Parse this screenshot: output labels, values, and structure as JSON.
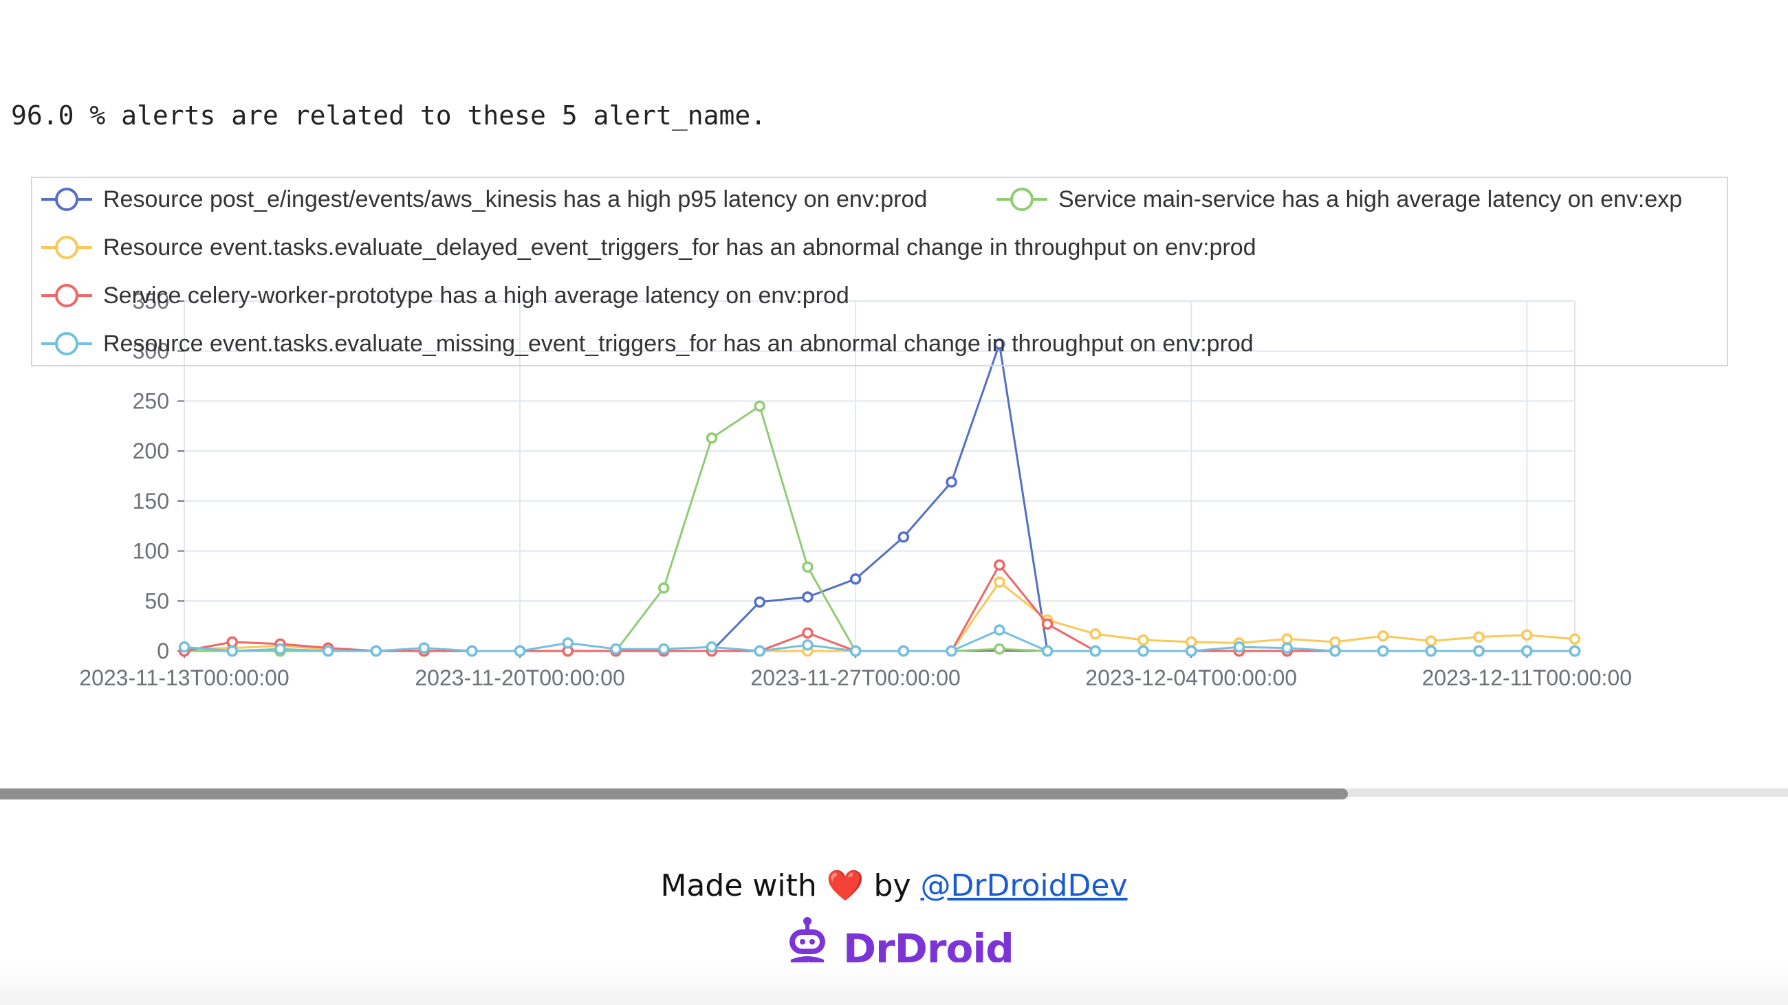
{
  "summary_text": "96.0 % alerts are related to these 5 alert_name.",
  "footer": {
    "made_with": "Made with",
    "heart": "❤️",
    "by": "by",
    "link": "@DrDroidDev",
    "brand_name": "DrDroid"
  },
  "chart_data": {
    "type": "line",
    "title": "",
    "xlabel": "",
    "ylabel": "",
    "ylim": [
      0,
      350
    ],
    "yticks": [
      0,
      50,
      100,
      150,
      200,
      250,
      300,
      350
    ],
    "x_tick_labels": [
      "2023-11-13T00:00:00",
      "2023-11-20T00:00:00",
      "2023-11-27T00:00:00",
      "2023-12-04T00:00:00",
      "2023-12-11T00:00:00"
    ],
    "x": [
      "2023-11-13",
      "2023-11-14",
      "2023-11-15",
      "2023-11-16",
      "2023-11-17",
      "2023-11-18",
      "2023-11-19",
      "2023-11-20",
      "2023-11-21",
      "2023-11-22",
      "2023-11-23",
      "2023-11-24",
      "2023-11-25",
      "2023-11-26",
      "2023-11-27",
      "2023-11-28",
      "2023-11-29",
      "2023-11-30",
      "2023-12-01",
      "2023-12-02",
      "2023-12-03",
      "2023-12-04",
      "2023-12-05",
      "2023-12-06",
      "2023-12-07",
      "2023-12-08",
      "2023-12-09",
      "2023-12-10",
      "2023-12-11",
      "2023-12-12"
    ],
    "grid": true,
    "legend_position": "top",
    "series": [
      {
        "name": "Resource post_e/ingest/events/aws_kinesis has a high p95 latency on env:prod",
        "color": "#5470c6",
        "values": [
          0,
          0,
          0,
          0,
          0,
          0,
          0,
          0,
          0,
          0,
          0,
          0,
          49,
          54,
          72,
          114,
          169,
          307,
          0,
          0,
          0,
          0,
          0,
          0,
          0,
          0,
          0,
          0,
          0,
          0
        ]
      },
      {
        "name": "Service main-service has a high average latency on env:exp",
        "color": "#91cc75",
        "values": [
          0,
          0,
          0,
          0,
          0,
          0,
          0,
          0,
          0,
          0,
          63,
          213,
          245,
          84,
          0,
          0,
          0,
          2,
          0,
          0,
          0,
          0,
          0,
          0,
          0,
          0,
          0,
          0,
          0,
          0
        ]
      },
      {
        "name": "Resource event.tasks.evaluate_delayed_event_triggers_for has an abnormal change in throughput on env:prod",
        "color": "#fac858",
        "values": [
          2,
          3,
          5,
          2,
          0,
          0,
          0,
          0,
          0,
          0,
          0,
          0,
          0,
          0,
          0,
          0,
          0,
          69,
          31,
          17,
          11,
          9,
          8,
          12,
          9,
          15,
          10,
          14,
          16,
          12
        ]
      },
      {
        "name": "Service celery-worker-prototype has a high average latency on env:prod",
        "color": "#ee6666",
        "values": [
          0,
          9,
          7,
          3,
          0,
          0,
          0,
          0,
          0,
          0,
          0,
          0,
          0,
          18,
          0,
          0,
          0,
          86,
          27,
          0,
          0,
          0,
          0,
          0,
          0,
          0,
          0,
          0,
          0,
          0
        ]
      },
      {
        "name": "Resource event.tasks.evaluate_missing_event_triggers_for has an abnormal change in throughput on env:prod",
        "color": "#73c0de",
        "values": [
          4,
          0,
          2,
          0,
          0,
          3,
          0,
          0,
          8,
          2,
          2,
          4,
          0,
          6,
          0,
          0,
          0,
          21,
          0,
          0,
          0,
          0,
          4,
          3,
          0,
          0,
          0,
          0,
          0,
          0
        ]
      }
    ]
  }
}
